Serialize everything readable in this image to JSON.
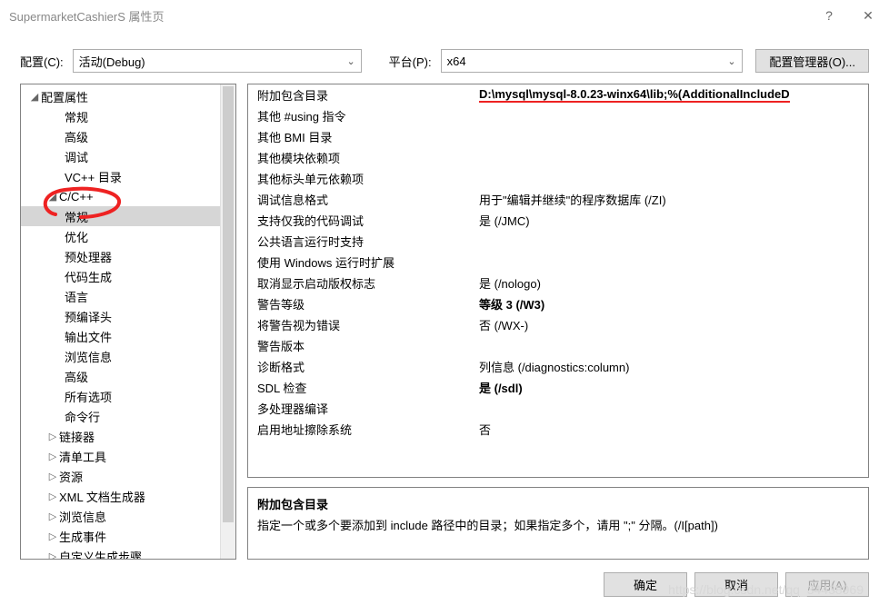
{
  "titlebar": {
    "title": "SupermarketCashierS 属性页",
    "help": "?",
    "close": "✕"
  },
  "toolbar": {
    "config_label": "配置(C):",
    "config_value": "活动(Debug)",
    "platform_label": "平台(P):",
    "platform_value": "x64",
    "config_mgr": "配置管理器(O)..."
  },
  "tree": {
    "root": "配置属性",
    "items_l1a": [
      "常规",
      "高级",
      "调试",
      "VC++ 目录"
    ],
    "cpp": "C/C++",
    "cpp_children": [
      "常规",
      "优化",
      "预处理器",
      "代码生成",
      "语言",
      "预编译头",
      "输出文件",
      "浏览信息",
      "高级",
      "所有选项",
      "命令行"
    ],
    "items_l1b": [
      "链接器",
      "清单工具",
      "资源",
      "XML 文档生成器",
      "浏览信息",
      "生成事件",
      "自定义生成步骤"
    ]
  },
  "props": [
    {
      "label": "附加包含目录",
      "value": "D:\\mysql\\mysql-8.0.23-winx64\\lib;%(AdditionalIncludeD",
      "bold": true,
      "underline": true
    },
    {
      "label": "其他 #using 指令",
      "value": ""
    },
    {
      "label": "其他 BMI 目录",
      "value": ""
    },
    {
      "label": "其他模块依赖项",
      "value": ""
    },
    {
      "label": "其他标头单元依赖项",
      "value": ""
    },
    {
      "label": "调试信息格式",
      "value": "用于\"编辑并继续\"的程序数据库 (/ZI)"
    },
    {
      "label": "支持仅我的代码调试",
      "value": "是 (/JMC)"
    },
    {
      "label": "公共语言运行时支持",
      "value": ""
    },
    {
      "label": "使用 Windows 运行时扩展",
      "value": ""
    },
    {
      "label": "取消显示启动版权标志",
      "value": "是 (/nologo)"
    },
    {
      "label": "警告等级",
      "value": "等级 3 (/W3)",
      "bold": true
    },
    {
      "label": "将警告视为错误",
      "value": "否 (/WX-)"
    },
    {
      "label": "警告版本",
      "value": ""
    },
    {
      "label": "诊断格式",
      "value": "列信息 (/diagnostics:column)"
    },
    {
      "label": "SDL 检查",
      "value": "是 (/sdl)",
      "bold": true
    },
    {
      "label": "多处理器编译",
      "value": ""
    },
    {
      "label": "启用地址擦除系统",
      "value": "否"
    }
  ],
  "desc": {
    "title": "附加包含目录",
    "text": "指定一个或多个要添加到 include 路径中的目录；如果指定多个，请用 \";\" 分隔。(/I[path])"
  },
  "footer": {
    "ok": "确定",
    "cancel": "取消",
    "apply": "应用(A)"
  },
  "watermark": "https://blog.csdn.net/qq_34438969"
}
